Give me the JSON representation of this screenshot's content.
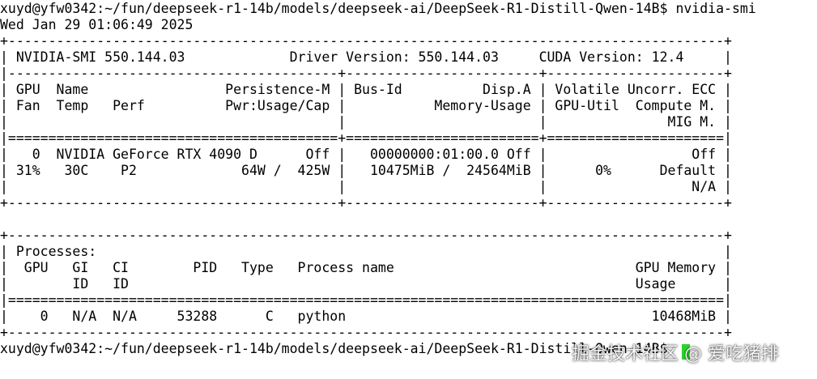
{
  "terminal": {
    "lines": [
      "xuyd@yfw0342:~/fun/deepseek-r1-14b/models/deepseek-ai/DeepSeek-R1-Distill-Qwen-14B$ nvidia-smi",
      "Wed Jan 29 01:06:49 2025",
      "+-----------------------------------------------------------------------------------------+",
      "| NVIDIA-SMI 550.144.03             Driver Version: 550.144.03     CUDA Version: 12.4     |",
      "|-----------------------------------------+------------------------+----------------------+",
      "| GPU  Name                 Persistence-M | Bus-Id          Disp.A | Volatile Uncorr. ECC |",
      "| Fan  Temp   Perf          Pwr:Usage/Cap |           Memory-Usage | GPU-Util  Compute M. |",
      "|                                         |                        |               MIG M. |",
      "|=========================================+========================+======================|",
      "|   0  NVIDIA GeForce RTX 4090 D      Off |   00000000:01:00.0 Off |                  Off |",
      "| 31%   30C    P2             64W /  425W |   10475MiB /  24564MiB |      0%      Default |",
      "|                                         |                        |                  N/A |",
      "+-----------------------------------------+------------------------+----------------------+",
      "",
      "+-----------------------------------------------------------------------------------------+",
      "| Processes:                                                                              |",
      "|  GPU   GI   CI        PID   Type   Process name                              GPU Memory |",
      "|        ID   ID                                                               Usage      |",
      "|=========================================================================================|",
      "|    0   N/A  N/A     53288      C   python                                      10468MiB |",
      "+-----------------------------------------------------------------------------------------+",
      "xuyd@yfw0342:~/fun/deepseek-r1-14b/models/deepseek-ai/DeepSeek-R1-Distill-Qwen-14B$"
    ]
  },
  "overlay": {
    "watermark": "掘金技术社区 @ 爱吃猪排",
    "cursor_color": "#2bd42b"
  }
}
